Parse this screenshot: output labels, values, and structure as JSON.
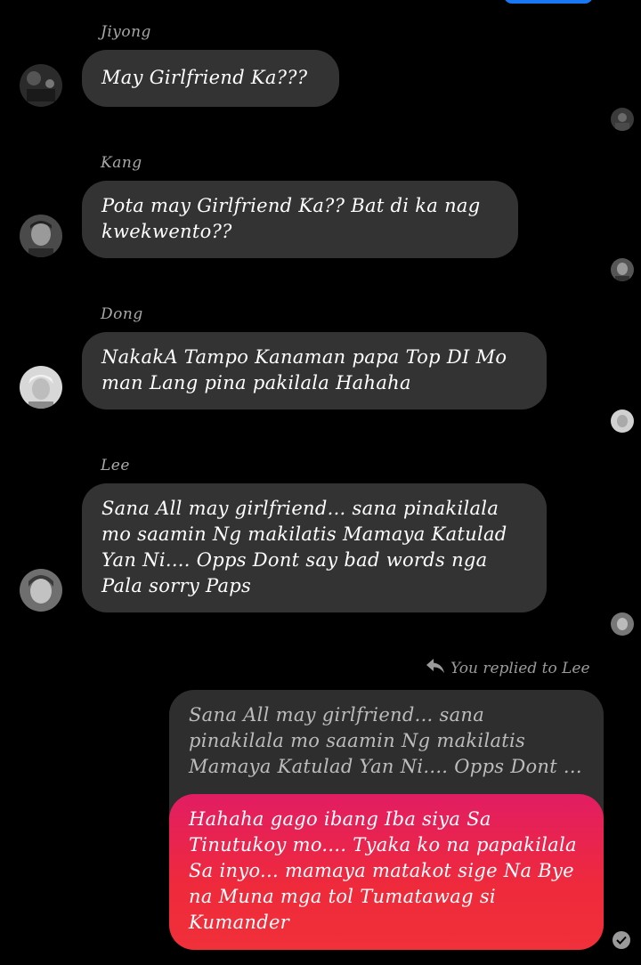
{
  "conversation": {
    "messages": [
      {
        "sender": "Jiyong",
        "text": "May Girlfriend Ka???"
      },
      {
        "sender": "Kang",
        "text": "Pota may Girlfriend Ka?? Bat di ka nag kwekwento??"
      },
      {
        "sender": "Dong",
        "text": "NakakA Tampo Kanaman papa Top DI Mo man Lang pina pakilala Hahaha"
      },
      {
        "sender": "Lee",
        "text": "Sana All may girlfriend...  sana pinakilala mo saamin Ng makilatis Mamaya Katulad Yan Ni.... Opps Dont say bad words nga Pala sorry Paps"
      }
    ]
  },
  "reply": {
    "context_label": "You replied to Lee",
    "quoted_text": "Sana All may girlfriend...  sana pinakilala mo saamin Ng makilatis Mamaya Katulad Yan Ni.... Opps Dont ...",
    "text": "Hahaha gago ibang Iba siya Sa Tinutukoy mo.... Tyaka ko na papakilala Sa inyo... mamaya matakot sige Na Bye na Muna mga tol Tumatawag si Kumander"
  },
  "icons": {
    "reply_arrow": "reply-arrow-icon",
    "delivered": "check-circle-icon"
  },
  "colors": {
    "background": "#000000",
    "incoming_bubble": "#333333",
    "outgoing_bubble_top": "#e21d63",
    "outgoing_bubble_bottom": "#f0303a",
    "accent": "#1877f2"
  }
}
